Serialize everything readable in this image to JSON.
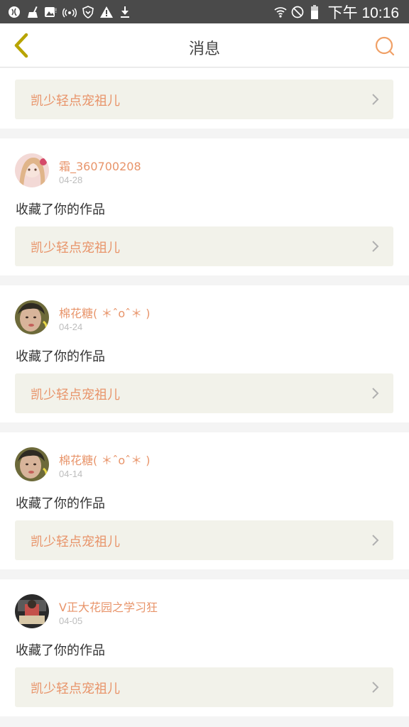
{
  "status_bar": {
    "time": "下午 10:16",
    "left_icons": [
      "app-icon",
      "cleaner-icon",
      "image-icon",
      "hotspot-icon",
      "vpn-shield-icon",
      "warning-icon",
      "download-icon"
    ],
    "right_icons": [
      "wifi-icon",
      "do-not-disturb-icon",
      "battery-icon"
    ]
  },
  "header": {
    "title": "消息",
    "back_icon": "chevron-left-icon",
    "search_icon": "search-icon"
  },
  "colors": {
    "accent": "#e8946a",
    "back_icon": "#b8a400",
    "link_bg": "#f2f2ea"
  },
  "messages": [
    {
      "work_title": "凯少轻点宠祖儿"
    },
    {
      "username": "霜_360700208",
      "date": "04-28",
      "action": "收藏了你的作品",
      "work_title": "凯少轻点宠祖儿"
    },
    {
      "username": "棉花糖( ＊ˆoˆ＊ )",
      "date": "04-24",
      "action": "收藏了你的作品",
      "work_title": "凯少轻点宠祖儿"
    },
    {
      "username": "棉花糖( ＊ˆoˆ＊ )",
      "date": "04-14",
      "action": "收藏了你的作品",
      "work_title": "凯少轻点宠祖儿"
    },
    {
      "username": "V正大花园之学习狂",
      "date": "04-05",
      "action": "收藏了你的作品",
      "work_title": "凯少轻点宠祖儿"
    }
  ]
}
